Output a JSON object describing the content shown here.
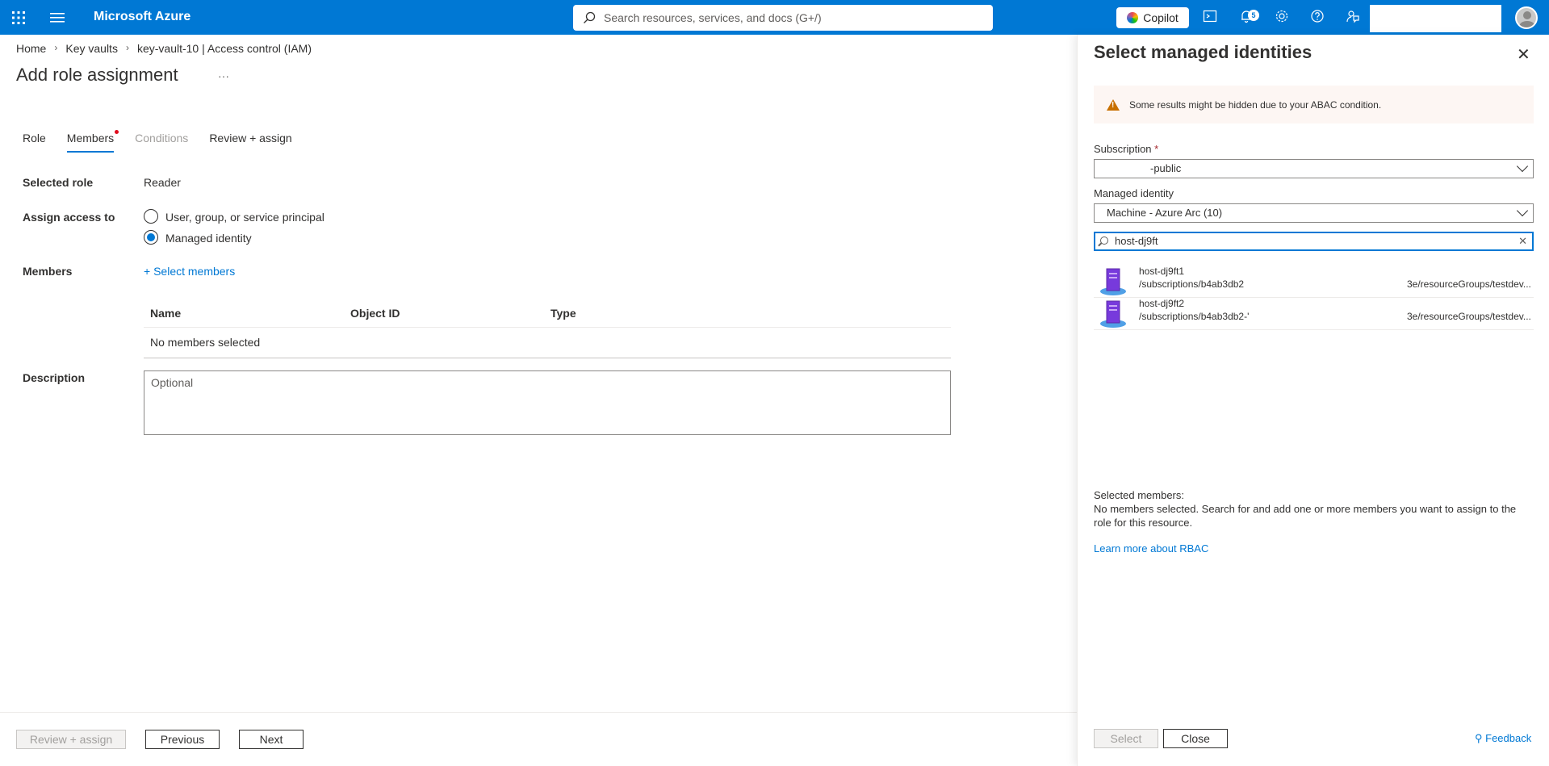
{
  "topbar": {
    "brand": "Microsoft Azure",
    "search_placeholder": "Search resources, services, and docs (G+/)",
    "copilot_label": "Copilot",
    "notification_count": "5"
  },
  "breadcrumb": {
    "items": [
      "Home",
      "Key vaults",
      "key-vault-10 | Access control (IAM)"
    ]
  },
  "page": {
    "title": "Add role assignment",
    "more": "···"
  },
  "tabs": [
    {
      "label": "Role"
    },
    {
      "label": "Members"
    },
    {
      "label": "Conditions"
    },
    {
      "label": "Review + assign"
    }
  ],
  "form": {
    "selected_role_label": "Selected role",
    "selected_role_value": "Reader",
    "assign_access_label": "Assign access to",
    "option_user": "User, group, or service principal",
    "option_managed": "Managed identity",
    "members_label": "Members",
    "select_members_link": "Select members",
    "table_headers": [
      "Name",
      "Object ID",
      "Type"
    ],
    "empty_row": "No members selected",
    "description_label": "Description",
    "description_placeholder": "Optional"
  },
  "footer": {
    "review_assign": "Review + assign",
    "previous": "Previous",
    "next": "Next"
  },
  "panel": {
    "title": "Select managed identities",
    "warning": "Some results might be hidden due to your ABAC condition.",
    "subscription_label": "Subscription",
    "subscription_required": "*",
    "subscription_value": "-public",
    "managed_identity_label": "Managed identity",
    "managed_identity_value": "Machine - Azure Arc (10)",
    "search_value": "host-dj9ft",
    "results": [
      {
        "name": "host-dj9ft1",
        "path": "/subscriptions/b4ab3db2",
        "path_tail": "3e/resourceGroups/testdev..."
      },
      {
        "name": "host-dj9ft2",
        "path": "/subscriptions/b4ab3db2-'",
        "path_tail": "3e/resourceGroups/testdev..."
      }
    ],
    "selected_members_label": "Selected members:",
    "selected_members_text": "No members selected. Search for and add one or more members you want to assign to the role for this resource.",
    "learn_more": "Learn more about RBAC",
    "select_button": "Select",
    "close_button": "Close",
    "feedback": "Feedback"
  }
}
